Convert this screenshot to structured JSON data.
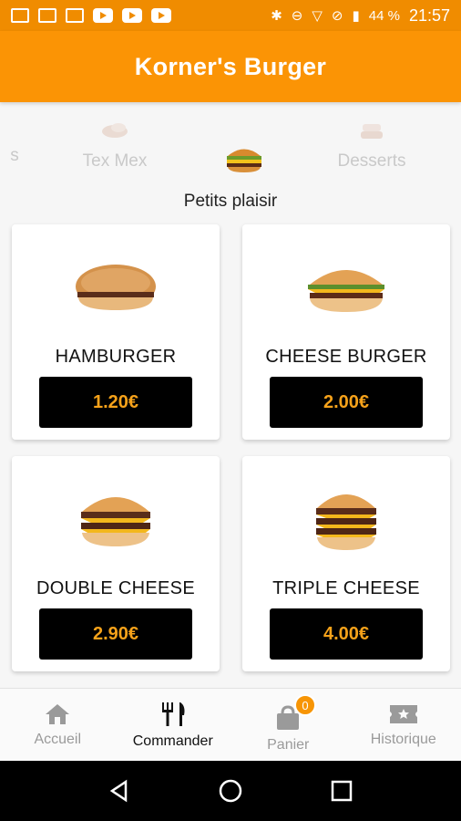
{
  "status_bar": {
    "battery": "44 %",
    "time": "21:57",
    "icons": [
      "gmail-icon",
      "mail-icon",
      "gmail-icon",
      "youtube-icon",
      "youtube-icon",
      "youtube-icon",
      "bluetooth-icon",
      "do-not-disturb-icon",
      "wifi-icon",
      "no-sim-icon",
      "battery-icon"
    ]
  },
  "app": {
    "title": "Korner's Burger",
    "accent": "#fb9405"
  },
  "categories": [
    {
      "label": "s",
      "icon": "food-icon",
      "active": false
    },
    {
      "label": "Tex Mex",
      "icon": "tex-mex-icon",
      "active": false
    },
    {
      "label": "",
      "icon": "burger-icon",
      "active": true
    },
    {
      "label": "Desserts",
      "icon": "dessert-icon",
      "active": false
    }
  ],
  "section_title": "Petits plaisir",
  "products": [
    {
      "name": "HAMBURGER",
      "price": "1.20€",
      "image": "hamburger"
    },
    {
      "name": "CHEESE BURGER",
      "price": "2.00€",
      "image": "cheeseburger"
    },
    {
      "name": "DOUBLE CHEESE",
      "price": "2.90€",
      "image": "double-cheese"
    },
    {
      "name": "TRIPLE CHEESE",
      "price": "4.00€",
      "image": "triple-cheese"
    }
  ],
  "bottom_nav": [
    {
      "label": "Accueil",
      "icon": "home-icon",
      "active": false
    },
    {
      "label": "Commander",
      "icon": "fork-knife-icon",
      "active": true
    },
    {
      "label": "Panier",
      "icon": "shopping-bag-icon",
      "active": false,
      "badge": "0"
    },
    {
      "label": "Historique",
      "icon": "ticket-icon",
      "active": false
    }
  ]
}
